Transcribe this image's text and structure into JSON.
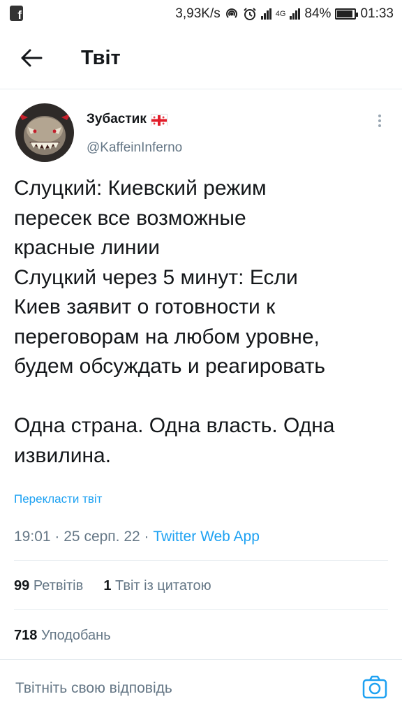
{
  "status_bar": {
    "network_speed": "3,93K/s",
    "network_type": "4G",
    "battery": "84%",
    "battery_level": 0.84,
    "time": "01:33"
  },
  "header": {
    "title": "Твіт"
  },
  "tweet": {
    "author_name": "Зубастик",
    "author_handle": "@KaffeinInferno",
    "text": "Слуцкий: Киевский режим\nпересек все возможные\nкрасные линии\nСлуцкий через 5 минут: Если\nКиев заявит о готовности к\nпереговорам на любом уровне,\nбудем обсуждать и реагировать\n\nОдна страна. Одна власть. Одна\nизвилина.",
    "translate_label": "Перекласти твіт",
    "time": "19:01",
    "date": "25 серп. 22",
    "separator": "·",
    "source": "Twitter Web App"
  },
  "stats": {
    "retweets_count": "99",
    "retweets_label": "Ретвітів",
    "quotes_count": "1",
    "quotes_label": "Твіт із цитатою",
    "likes_count": "718",
    "likes_label": "Уподобань"
  },
  "reply": {
    "placeholder": "Твітніть свою відповідь"
  },
  "colors": {
    "accent": "#1da1f2",
    "secondary_text": "#657786",
    "divider": "#e6ecf0"
  },
  "icons": [
    "facebook-icon",
    "hotspot-icon",
    "alarm-icon",
    "signal-icon",
    "battery-icon",
    "back-arrow-icon",
    "georgia-flag-icon",
    "more-vertical-icon",
    "camera-icon"
  ]
}
